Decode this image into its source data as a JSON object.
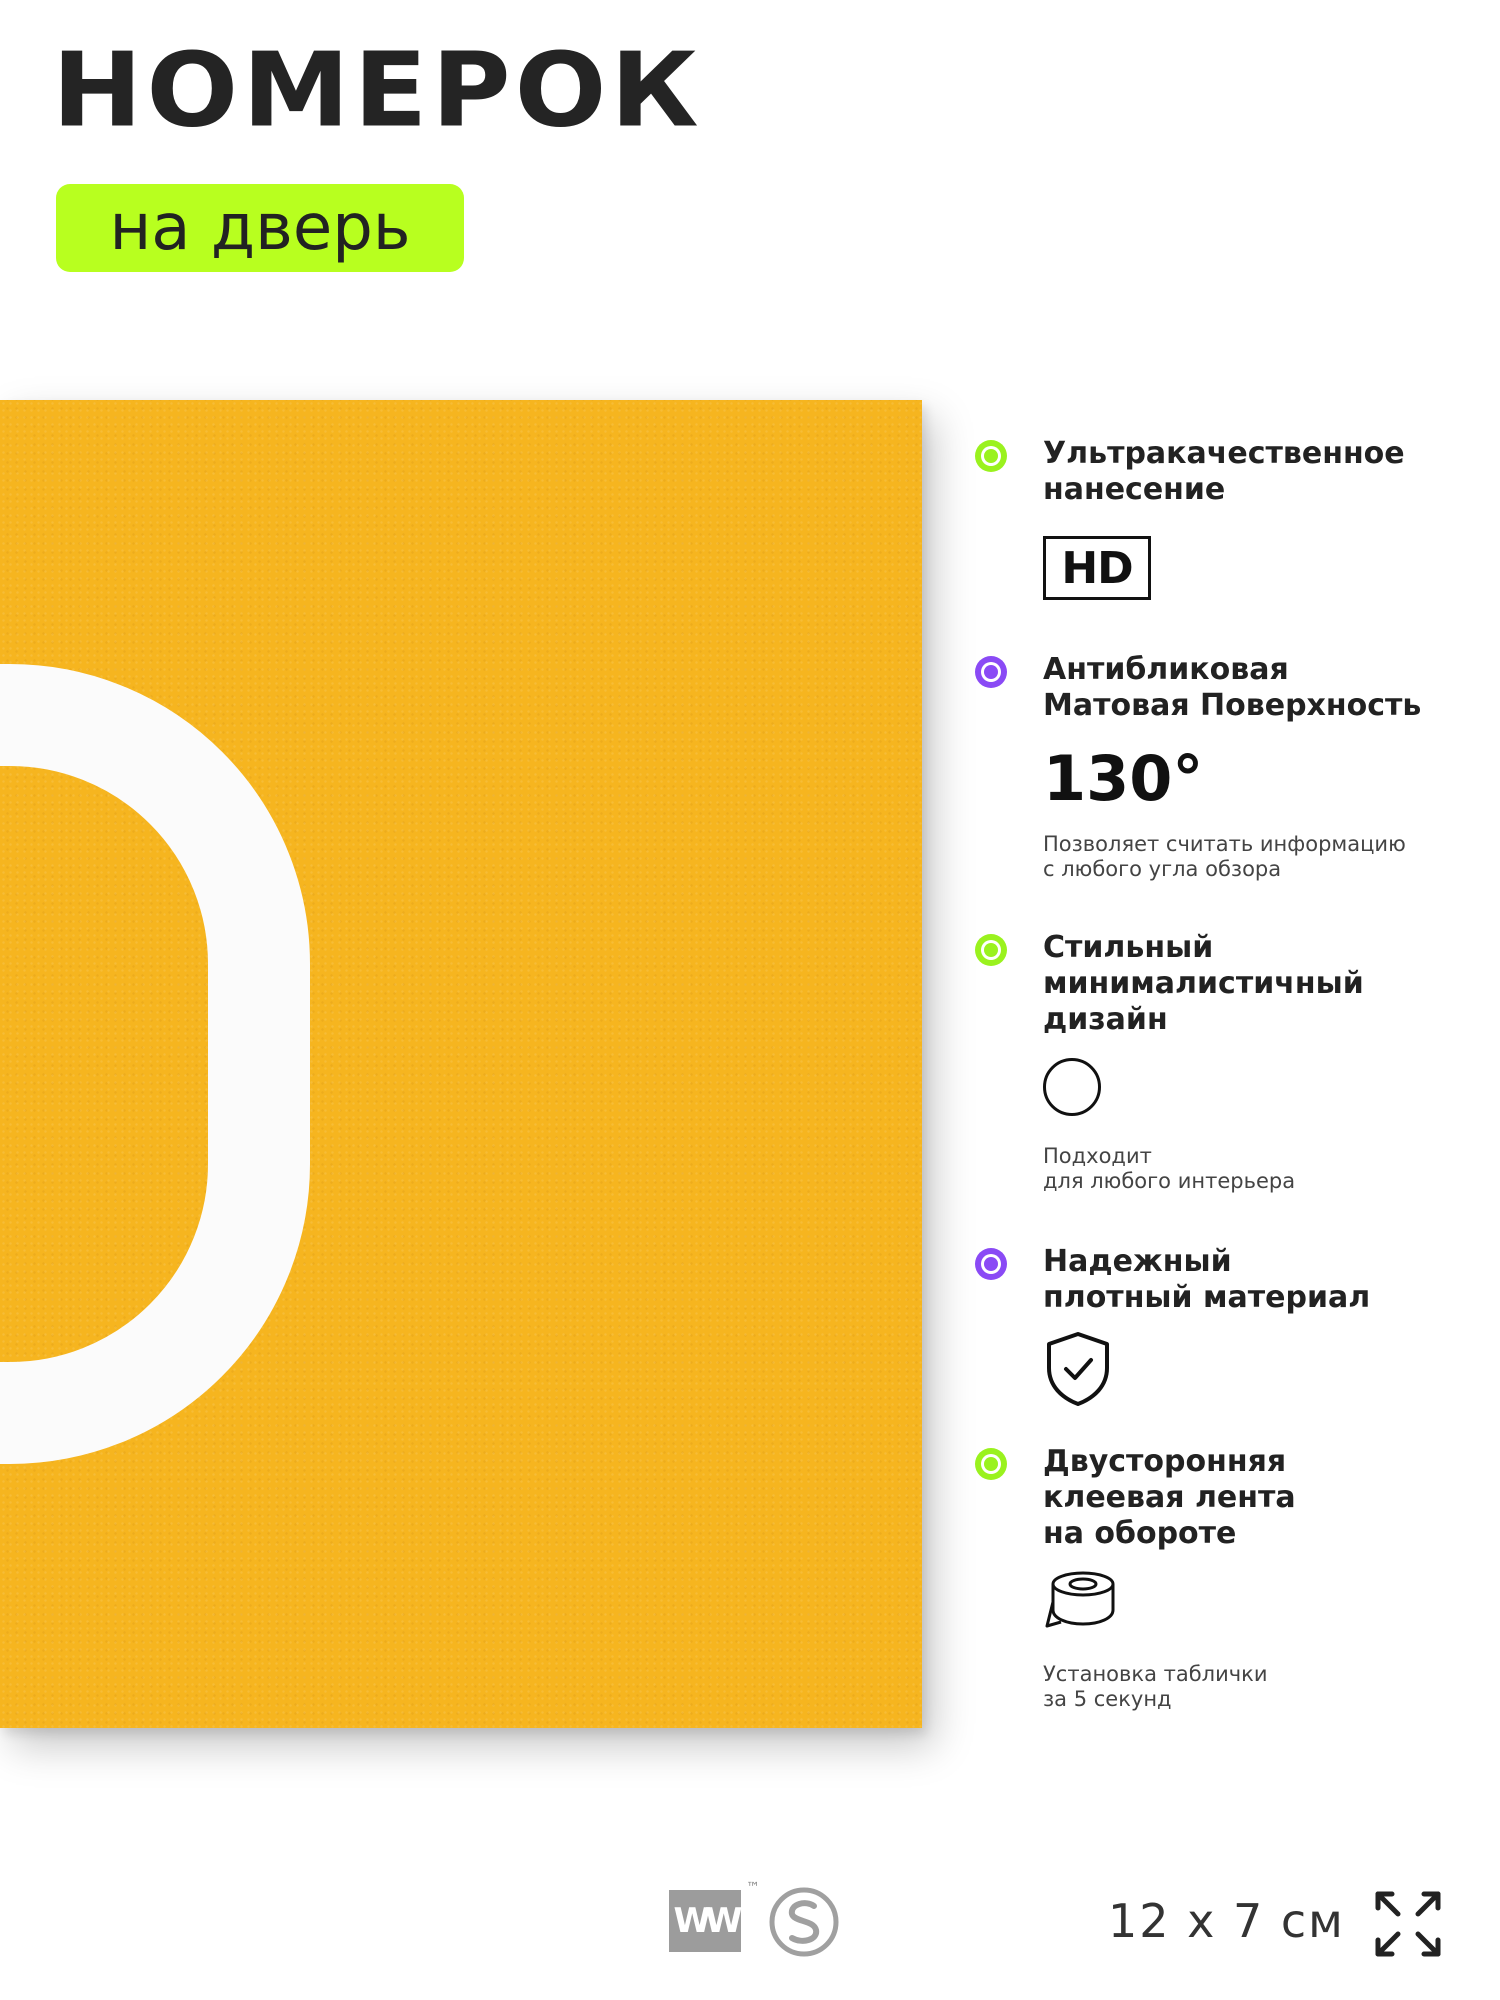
{
  "header": {
    "title": "НОМЕРОК",
    "subtitle": "на дверь"
  },
  "colors": {
    "accent_green": "#b8ff1f",
    "accent_purple": "#8a4af5",
    "sign_yellow": "#f6b51f"
  },
  "features": [
    {
      "title": "Ультракачественное\nнанесение",
      "bullet_color": "green",
      "badge": "HD",
      "icon": "hd-icon"
    },
    {
      "title": "Антибликовая\nМатовая Поверхность",
      "bullet_color": "purple",
      "value": "130°",
      "note": "Позволяет считать информацию\nс любого угла обзора"
    },
    {
      "title": "Стильный\nминималистичный\nдизайн",
      "bullet_color": "green",
      "icon": "circle-icon",
      "note": "Подходит\nдля любого интерьера"
    },
    {
      "title": "Надежный\nплотный материал",
      "bullet_color": "purple",
      "icon": "shield-check-icon"
    },
    {
      "title": "Двусторонняя\nклеевая лента\nна обороте",
      "bullet_color": "green",
      "icon": "tape-icon",
      "note": "Установка таблички\nза 5 секунд"
    }
  ],
  "footer": {
    "logo_text": "W",
    "trademark": "™",
    "size": "12 x 7 см",
    "icons": [
      "brand-w-logo",
      "brand-s-logo",
      "expand-arrows-icon"
    ]
  }
}
